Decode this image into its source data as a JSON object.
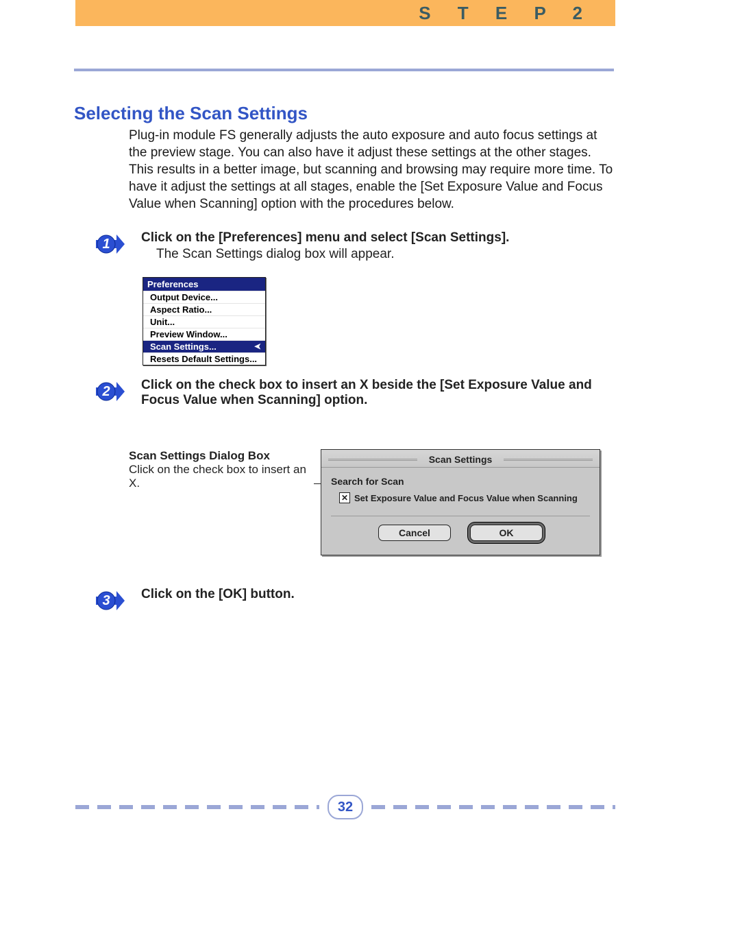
{
  "header": {
    "step_text": "S T E P   2"
  },
  "title": "Selecting the Scan Settings",
  "intro": "Plug-in module FS generally adjusts the auto exposure and auto focus settings at the preview stage. You can also have it adjust these settings at the other stages. This results in a better image, but scanning and browsing may require more time. To have it adjust the settings at all stages, enable the [Set Exposure Value and Focus Value when Scanning] option with the procedures below.",
  "steps": {
    "s1": {
      "num": "1",
      "title": "Click on the [Preferences] menu and select [Scan Settings].",
      "desc": "The Scan Settings dialog box will appear."
    },
    "s2": {
      "num": "2",
      "title": "Click on the check box to insert an X beside the [Set Exposure Value and Focus Value when Scanning] option."
    },
    "s3": {
      "num": "3",
      "title": "Click on the [OK] button."
    }
  },
  "prefs_menu": {
    "title": "Preferences",
    "items": {
      "i0": "Output Device...",
      "i1": "Aspect Ratio...",
      "i2": "Unit...",
      "i3": "Preview Window...",
      "i4": "Scan Settings...",
      "i5": "Resets Default Settings..."
    }
  },
  "dialog_label": {
    "title": "Scan Settings Dialog Box",
    "desc": "Click on the check box to insert an X."
  },
  "dialog": {
    "title": "Scan Settings",
    "section": "Search for Scan",
    "check_label": "Set Exposure Value and Focus Value when Scanning",
    "check_mark": "☒",
    "cancel": "Cancel",
    "ok": "OK"
  },
  "page_number": "32"
}
